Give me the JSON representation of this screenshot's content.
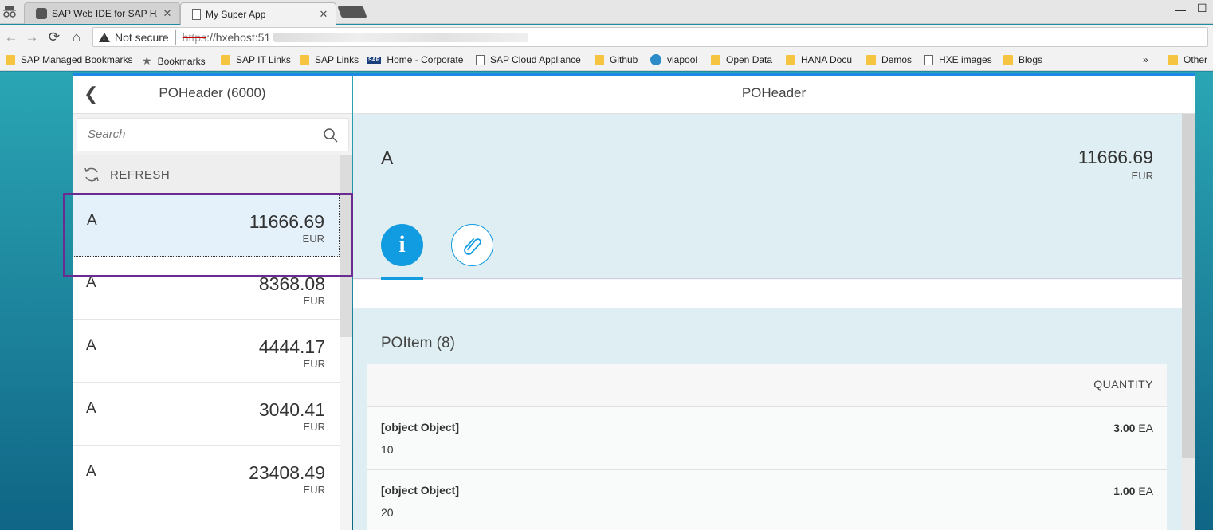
{
  "browser": {
    "tabs": [
      {
        "label": "SAP Web IDE for SAP HA",
        "active": false
      },
      {
        "label": "My Super App",
        "active": true
      }
    ],
    "address": {
      "security": "Not secure",
      "scheme": "https",
      "host": "://hxehost:51"
    },
    "bookmarks": [
      {
        "label": "SAP Managed Bookmarks",
        "icon": "folder-icon"
      },
      {
        "label": "Bookmarks",
        "icon": "star-icon"
      },
      {
        "label": "SAP IT Links",
        "icon": "folder-icon"
      },
      {
        "label": "SAP Links",
        "icon": "folder-icon"
      },
      {
        "label": "Home - Corporate",
        "icon": "sap-logo-icon"
      },
      {
        "label": "SAP Cloud Appliance",
        "icon": "page-icon"
      },
      {
        "label": "Github",
        "icon": "folder-icon"
      },
      {
        "label": "viapool",
        "icon": "viapool-icon"
      },
      {
        "label": "Open Data",
        "icon": "folder-icon"
      },
      {
        "label": "HANA Docu",
        "icon": "folder-icon"
      },
      {
        "label": "Demos",
        "icon": "folder-icon"
      },
      {
        "label": "HXE images",
        "icon": "page-icon"
      },
      {
        "label": "Blogs",
        "icon": "folder-icon"
      }
    ],
    "overflow": "»",
    "other": "Other"
  },
  "master": {
    "title": "POHeader (6000)",
    "search_placeholder": "Search",
    "refresh_label": "REFRESH",
    "items": [
      {
        "title": "A",
        "amount": "11666.69",
        "unit": "EUR",
        "selected": true
      },
      {
        "title": "A",
        "amount": "8368.08",
        "unit": "EUR"
      },
      {
        "title": "A",
        "amount": "4444.17",
        "unit": "EUR"
      },
      {
        "title": "A",
        "amount": "3040.41",
        "unit": "EUR"
      },
      {
        "title": "A",
        "amount": "23408.49",
        "unit": "EUR"
      }
    ]
  },
  "detail": {
    "title": "POHeader",
    "object": {
      "title": "A",
      "amount": "11666.69",
      "unit": "EUR"
    },
    "section": {
      "title": "POItem (8)",
      "column_header": "QUANTITY",
      "rows": [
        {
          "title": "[object Object]",
          "sub": "10",
          "qty": "3.00",
          "uom": "EA"
        },
        {
          "title": "[object Object]",
          "sub": "20",
          "qty": "1.00",
          "uom": "EA"
        }
      ]
    }
  },
  "colors": {
    "accent": "#119be0",
    "highlight": "#6a2c91",
    "shell": "#1e88e5"
  }
}
